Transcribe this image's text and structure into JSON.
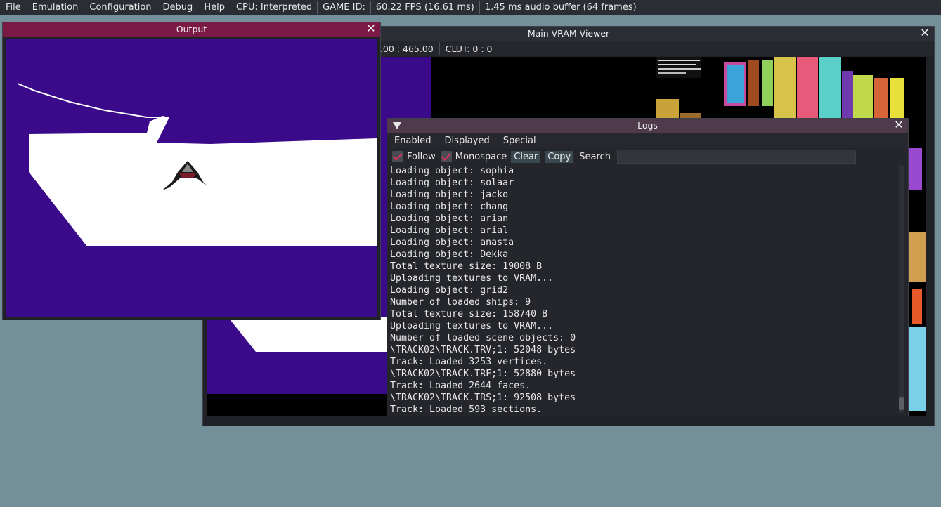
{
  "menubar": {
    "items": [
      "File",
      "Emulation",
      "Configuration",
      "Debug",
      "Help"
    ],
    "cpu": "CPU: Interpreted",
    "game_id": "GAME ID:",
    "fps": "60.22 FPS (16.61 ms)",
    "audio": "1.45 ms audio buffer (64 frames)"
  },
  "vram": {
    "title": "Main VRAM Viewer",
    "coords": "5.00 : 465.00",
    "clut": "CLUT: 0 : 0",
    "colors": {
      "purple": "#3a0a8a",
      "black": "#000000"
    }
  },
  "output": {
    "title": "Output",
    "colors": {
      "sky": "#3a0a8a",
      "track": "#ffffff",
      "title_bar": "#7a1a44"
    }
  },
  "logs": {
    "title": "Logs",
    "menus": [
      "Enabled",
      "Displayed",
      "Special"
    ],
    "follow": "Follow",
    "monospace": "Monospace",
    "clear": "Clear",
    "copy": "Copy",
    "search_label": "Search",
    "search_value": "",
    "lines": [
      "Loading object: sophia",
      "Loading object: solaar",
      "Loading object: jacko",
      "Loading object: chang",
      "Loading object: arian",
      "Loading object: arial",
      "Loading object: anasta",
      "Loading object: Dekka",
      "Total texture size: 19008 B",
      "Uploading textures to VRAM...",
      "Loading object: grid2",
      "Number of loaded ships: 9",
      "Total texture size: 158740 B",
      "Uploading textures to VRAM...",
      "Number of loaded scene objects: 0",
      "\\TRACK02\\TRACK.TRV;1: 52048 bytes",
      "Track: Loaded 3253 vertices.",
      "\\TRACK02\\TRACK.TRF;1: 52880 bytes",
      "Track: Loaded 2644 faces.",
      "\\TRACK02\\TRACK.TRS;1: 92508 bytes",
      "Track: Loaded 593 sections."
    ]
  }
}
